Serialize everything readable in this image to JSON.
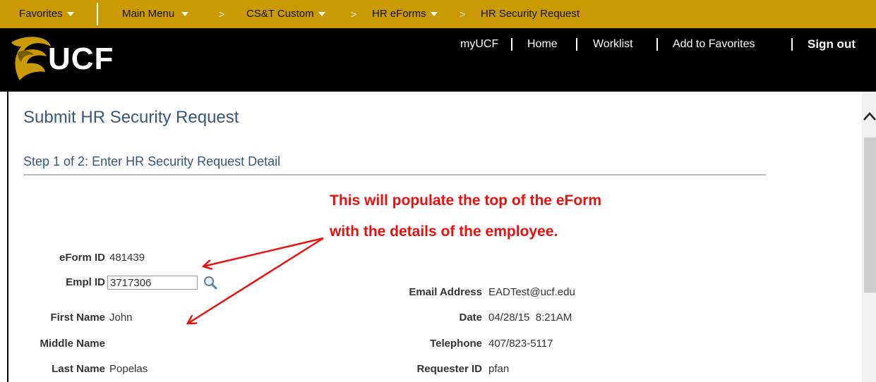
{
  "nav": {
    "favorites": "Favorites",
    "main_menu": "Main Menu",
    "breadcrumb": [
      "CS&T Custom",
      "HR eForms",
      "HR Security Request"
    ]
  },
  "header": {
    "logo_text": "UCF",
    "links": [
      "myUCF",
      "Home",
      "Worklist",
      "Add to Favorites"
    ],
    "sign_out": "Sign out"
  },
  "page": {
    "title": "Submit HR Security Request",
    "step": "Step 1 of 2: Enter HR Security Request Detail"
  },
  "annotation": {
    "line1": "This will populate the top of the eForm",
    "line2": "with the details of the employee."
  },
  "form": {
    "eform_id": {
      "label": "eForm ID",
      "value": "481439"
    },
    "empl_id": {
      "label": "Empl ID",
      "value": "3717306"
    },
    "first_name": {
      "label": "First Name",
      "value": "John"
    },
    "middle_name": {
      "label": "Middle Name",
      "value": ""
    },
    "last_name": {
      "label": "Last Name",
      "value": "Popelas"
    },
    "email": {
      "label": "Email Address",
      "value": "EADTest@ucf.edu"
    },
    "date": {
      "label": "Date",
      "value": "04/28/15  8:21AM"
    },
    "telephone": {
      "label": "Telephone",
      "value": "407/823-5117"
    },
    "requester_id": {
      "label": "Requester ID",
      "value": "pfan"
    }
  },
  "colors": {
    "nav_gold": "#c99a04",
    "header_black": "#000000",
    "title_blue": "#37577a",
    "annotation_red": "#e8110f"
  }
}
